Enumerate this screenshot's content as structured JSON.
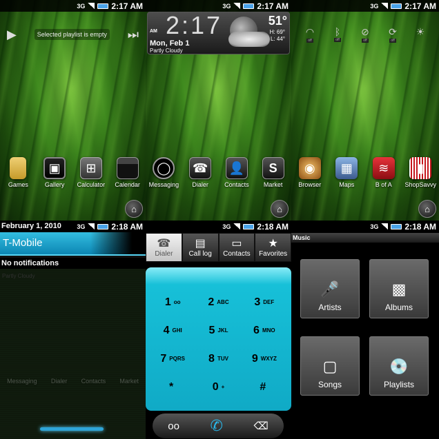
{
  "status": {
    "net": "3G",
    "time_top": "2:17 AM",
    "time_bottom": "2:18 AM"
  },
  "panel1": {
    "music_text": "Selected playlist is empty",
    "dock": [
      {
        "label": "Games",
        "icon": "folder-icon"
      },
      {
        "label": "Gallery",
        "icon": "gallery-icon"
      },
      {
        "label": "Calculator",
        "icon": "calculator-icon"
      },
      {
        "label": "Calendar",
        "icon": "calendar-icon"
      }
    ]
  },
  "panel2": {
    "clock": {
      "ampm": "AM",
      "digits": "2:17",
      "date": "Mon, Feb 1",
      "condition": "Partly Cloudy"
    },
    "weather": {
      "temp": "51°",
      "high": "H: 69°",
      "low": "L: 44°"
    },
    "dock": [
      {
        "label": "Messaging",
        "icon": "messaging-icon"
      },
      {
        "label": "Dialer",
        "icon": "phone-icon"
      },
      {
        "label": "Contacts",
        "icon": "contacts-icon"
      },
      {
        "label": "Market",
        "icon": "market-icon"
      }
    ]
  },
  "panel3": {
    "toggles": [
      {
        "icon": "wifi-icon",
        "state": "off"
      },
      {
        "icon": "bluetooth-icon",
        "state": "off"
      },
      {
        "icon": "gps-icon",
        "state": "off"
      },
      {
        "icon": "sync-icon",
        "state": "off"
      },
      {
        "icon": "brightness-icon",
        "state": ""
      }
    ],
    "dock": [
      {
        "label": "Browser",
        "icon": "browser-icon"
      },
      {
        "label": "Maps",
        "icon": "maps-icon"
      },
      {
        "label": "B of A",
        "icon": "bank-icon"
      },
      {
        "label": "ShopSavvy",
        "icon": "barcode-icon"
      }
    ]
  },
  "panel4": {
    "date": "February 1, 2010",
    "carrier": "T-Mobile",
    "no_notifications": "No notifications",
    "ghost_text": "Partly Cloudy",
    "ghost_dock": [
      "Messaging",
      "Dialer",
      "Contacts",
      "Market"
    ]
  },
  "panel5": {
    "tabs": [
      {
        "label": "Dialer",
        "icon": "phone-icon",
        "active": true
      },
      {
        "label": "Call log",
        "icon": "call-log-icon",
        "active": false
      },
      {
        "label": "Contacts",
        "icon": "contacts-folder-icon",
        "active": false
      },
      {
        "label": "Favorites",
        "icon": "star-icon",
        "active": false
      }
    ],
    "keys": [
      {
        "digit": "1",
        "letters": "oo"
      },
      {
        "digit": "2",
        "letters": "ABC"
      },
      {
        "digit": "3",
        "letters": "DEF"
      },
      {
        "digit": "4",
        "letters": "GHI"
      },
      {
        "digit": "5",
        "letters": "JKL"
      },
      {
        "digit": "6",
        "letters": "MNO"
      },
      {
        "digit": "7",
        "letters": "PQRS"
      },
      {
        "digit": "8",
        "letters": "TUV"
      },
      {
        "digit": "9",
        "letters": "WXYZ"
      },
      {
        "digit": "*",
        "letters": ""
      },
      {
        "digit": "0",
        "letters": "+"
      },
      {
        "digit": "#",
        "letters": ""
      }
    ]
  },
  "panel6": {
    "header": "Music",
    "tiles": [
      {
        "label": "Artists",
        "icon": "microphone-icon"
      },
      {
        "label": "Albums",
        "icon": "album-icon"
      },
      {
        "label": "Songs",
        "icon": "ipod-icon"
      },
      {
        "label": "Playlists",
        "icon": "cd-icon"
      }
    ]
  },
  "colors": {
    "accent": "#1ab3d2",
    "grass": "#4a9a20"
  }
}
